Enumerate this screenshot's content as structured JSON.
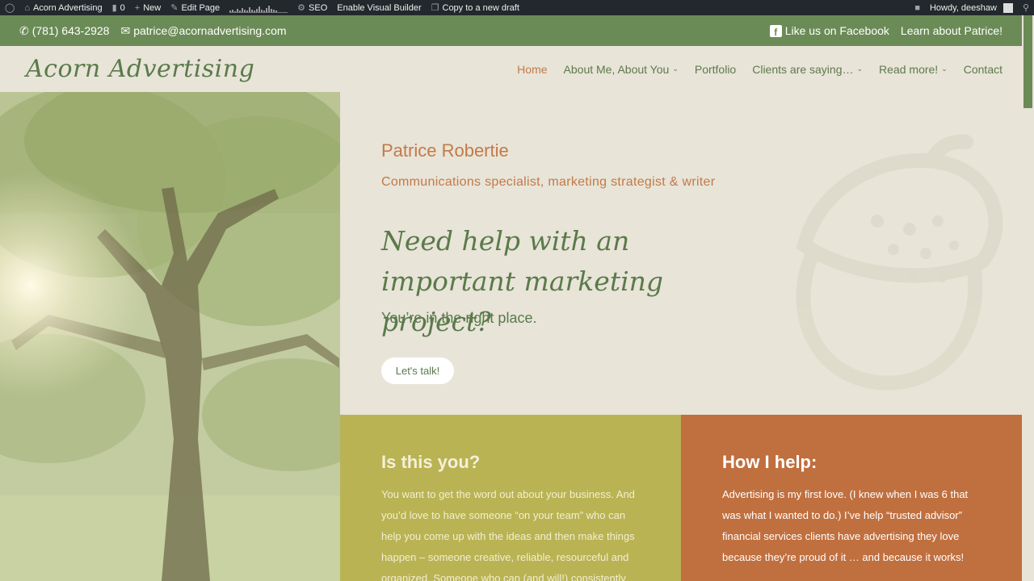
{
  "adminbar": {
    "site_name": "Acorn Advertising",
    "comments_count": "0",
    "new_label": "New",
    "edit_label": "Edit Page",
    "seo_label": "SEO",
    "visual_builder_label": "Enable Visual Builder",
    "copy_draft_label": "Copy to a new draft",
    "howdy_label": "Howdy, deeshaw"
  },
  "topbar": {
    "phone": "(781) 643-2928",
    "email": "patrice@acornadvertising.com",
    "facebook_label": "Like us on Facebook",
    "learn_label": "Learn about Patrice!"
  },
  "header": {
    "logo": "Acorn Advertising",
    "nav": [
      {
        "label": "Home"
      },
      {
        "label": "About Me, About You"
      },
      {
        "label": "Portfolio"
      },
      {
        "label": "Clients are saying…"
      },
      {
        "label": "Read more!"
      },
      {
        "label": "Contact"
      }
    ]
  },
  "hero": {
    "name": "Patrice Robertie",
    "role": "Communications specialist, marketing strategist & writer",
    "headline": "Need help with an important marketing project?",
    "subheadline": "You’re in the right place.",
    "cta_label": "Let's talk!"
  },
  "columns": {
    "left": {
      "title": "Is this you?",
      "text": "You want to get the word out about your business. And you’d love to have someone “on your team” who can help you come up with the ideas and then make things happen – someone creative, reliable, resourceful and organized. Someone who can (and will!) consistently"
    },
    "right": {
      "title": "How I help:",
      "text": "Advertising is my first love. (I knew when I was 6 that was what I wanted to do.) I’ve help “trusted advisor” financial services clients have advertising they love because they’re proud of it … and because it works!"
    }
  },
  "colors": {
    "green": "#6b8b56",
    "orange": "#c27a48",
    "olive": "#b9b354",
    "rust": "#c06f3e",
    "cream": "#e8e4d8"
  }
}
